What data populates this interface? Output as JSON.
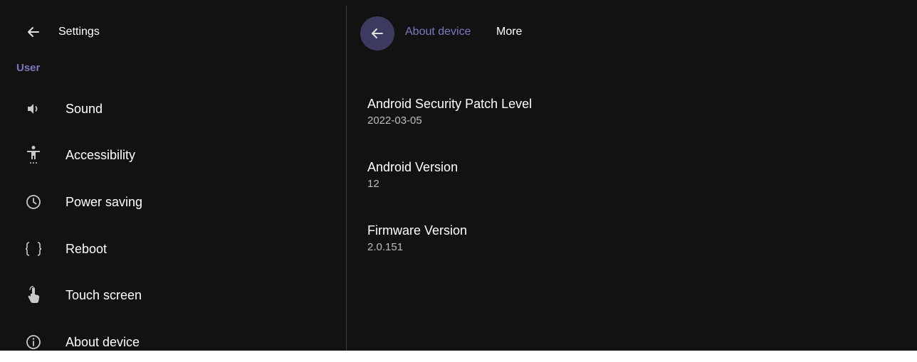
{
  "left": {
    "title": "Settings",
    "section": "User",
    "items": [
      {
        "label": "Sound",
        "icon": "speaker-icon"
      },
      {
        "label": "Accessibility",
        "icon": "accessibility-icon"
      },
      {
        "label": "Power saving",
        "icon": "clock-icon"
      },
      {
        "label": "Reboot",
        "icon": "braces-icon"
      },
      {
        "label": "Touch screen",
        "icon": "touch-icon"
      },
      {
        "label": "About device",
        "icon": "info-icon"
      }
    ]
  },
  "right": {
    "breadcrumb": {
      "parent": "About device",
      "current": "More"
    },
    "info": [
      {
        "title": "Android Security Patch Level",
        "value": "2022-03-05"
      },
      {
        "title": "Android Version",
        "value": "12"
      },
      {
        "title": "Firmware Version",
        "value": "2.0.151"
      }
    ]
  },
  "colors": {
    "background": "#121212",
    "accent": "#7b78c2",
    "back_circle": "#3d3a60",
    "divider": "#3a3a3a"
  }
}
